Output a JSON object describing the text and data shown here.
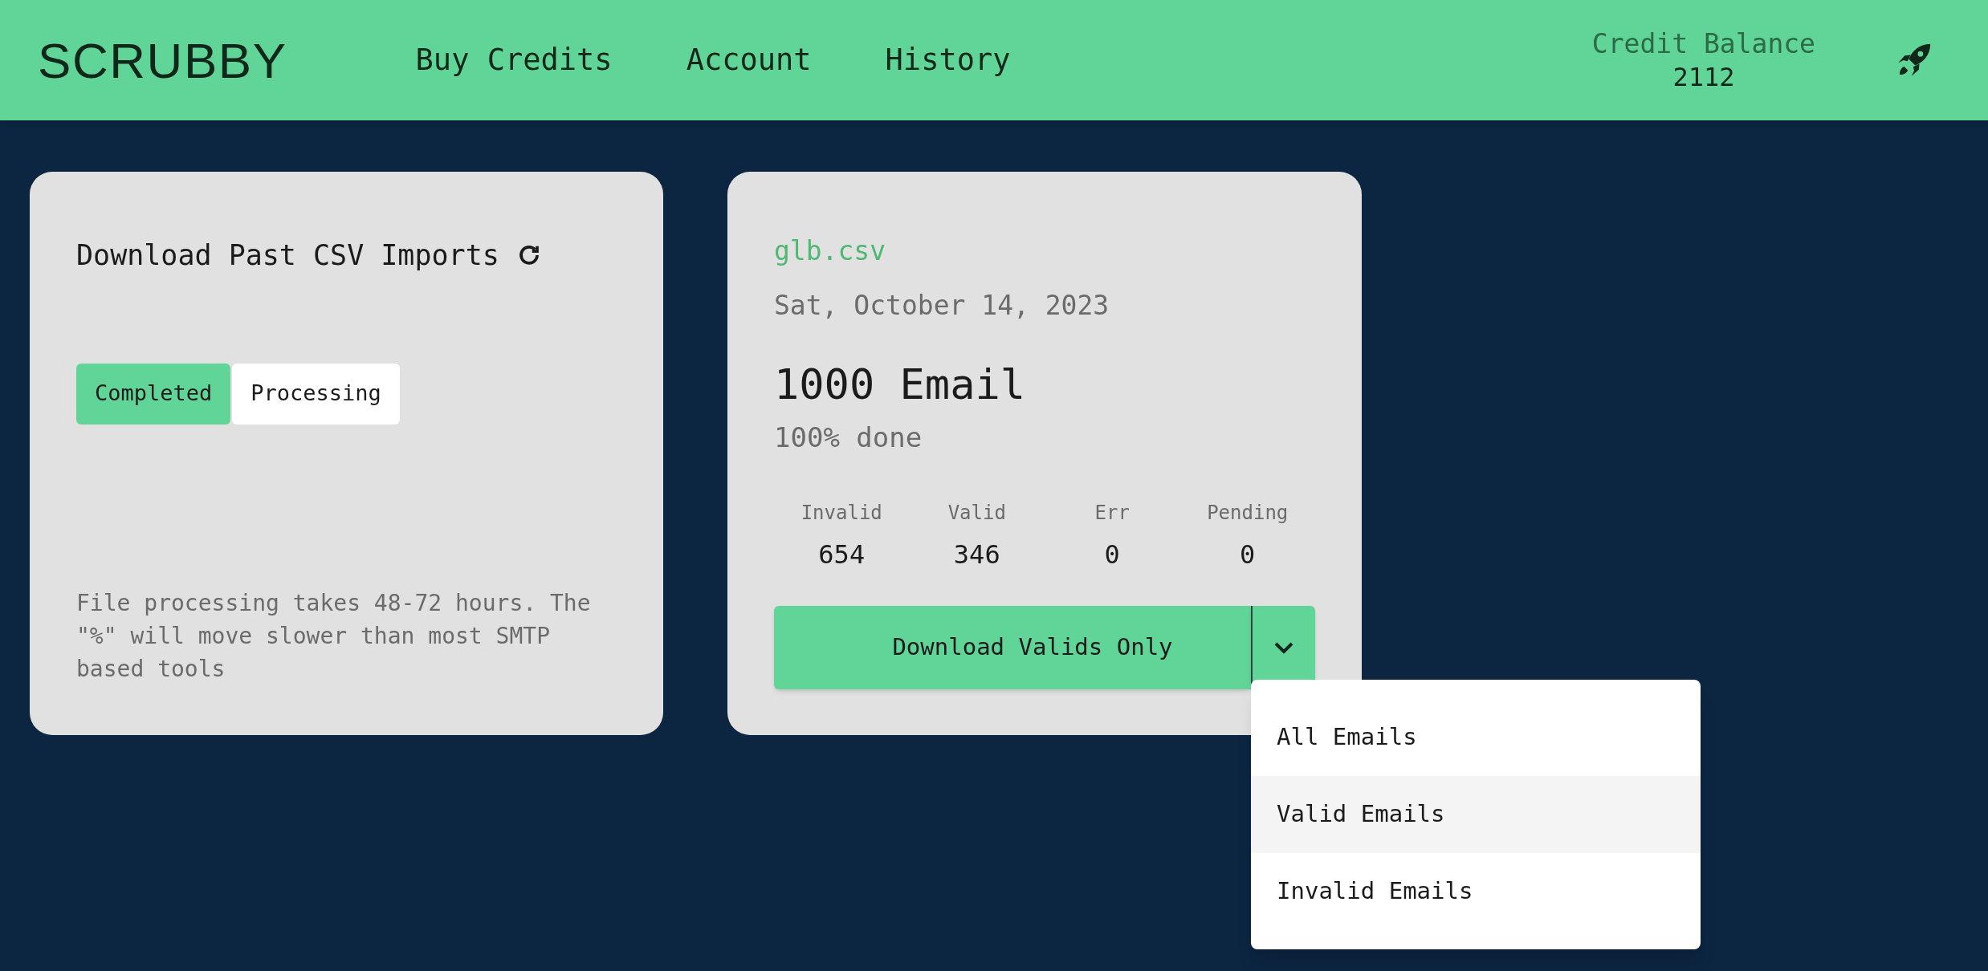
{
  "header": {
    "logo": "SCRUBBY",
    "nav": [
      "Buy Credits",
      "Account",
      "History"
    ],
    "credit_label": "Credit Balance",
    "credit_value": "2112"
  },
  "imports_card": {
    "title": "Download Past CSV Imports",
    "tabs": [
      {
        "label": "Completed",
        "selected": true
      },
      {
        "label": "Processing",
        "selected": false
      }
    ],
    "note": "File processing takes 48-72 hours. The \"%\" will move slower than most SMTP based tools"
  },
  "file_card": {
    "filename": "glb.csv",
    "date": "Sat, October 14, 2023",
    "count": "1000 Email",
    "progress": "100% done",
    "stats": [
      {
        "label": "Invalid",
        "value": "654"
      },
      {
        "label": "Valid",
        "value": "346"
      },
      {
        "label": "Err",
        "value": "0"
      },
      {
        "label": "Pending",
        "value": "0"
      }
    ],
    "download_button": "Download Valids Only",
    "dropdown": {
      "expanded": true,
      "items": [
        {
          "label": "All Emails",
          "selected": false
        },
        {
          "label": "Valid Emails",
          "selected": true
        },
        {
          "label": "Invalid Emails",
          "selected": false
        }
      ]
    }
  }
}
